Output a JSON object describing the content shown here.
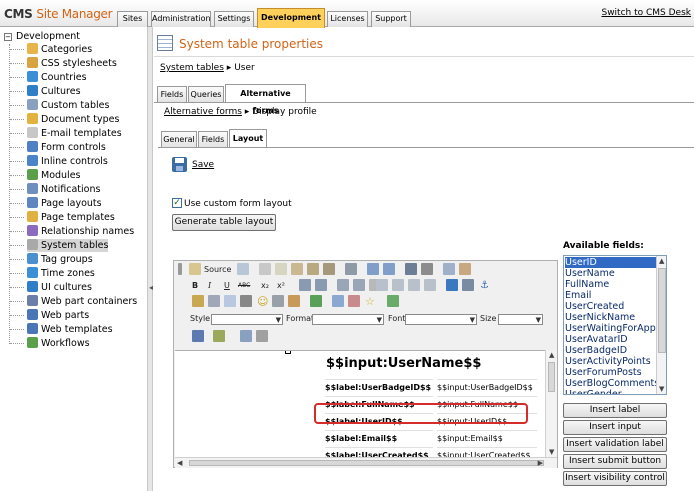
{
  "app": {
    "logo_cms": "CMS",
    "logo_sm": "Site Manager",
    "switch_link": "Switch to CMS Desk"
  },
  "top_tabs": [
    {
      "label": "Sites"
    },
    {
      "label": "Administration"
    },
    {
      "label": "Settings"
    },
    {
      "label": "Development"
    },
    {
      "label": "Licenses"
    },
    {
      "label": "Support"
    }
  ],
  "tree": {
    "root": "Development",
    "items": [
      {
        "label": "Categories",
        "icon": "categories-icon",
        "color": "#e8b44a"
      },
      {
        "label": "CSS stylesheets",
        "icon": "css-icon",
        "color": "#d9a340"
      },
      {
        "label": "Countries",
        "icon": "globe-icon",
        "color": "#3b8fd6"
      },
      {
        "label": "Cultures",
        "icon": "globe-icon",
        "color": "#2f7fc8"
      },
      {
        "label": "Custom tables",
        "icon": "table-icon",
        "color": "#8aa0c0"
      },
      {
        "label": "Document types",
        "icon": "document-types-icon",
        "color": "#e3b23e"
      },
      {
        "label": "E-mail templates",
        "icon": "email-icon",
        "color": "#c7c7c7"
      },
      {
        "label": "Form controls",
        "icon": "form-controls-icon",
        "color": "#4f7fc4"
      },
      {
        "label": "Inline controls",
        "icon": "inline-controls-icon",
        "color": "#4b83c8"
      },
      {
        "label": "Modules",
        "icon": "modules-icon",
        "color": "#5aa04a"
      },
      {
        "label": "Notifications",
        "icon": "notifications-icon",
        "color": "#6f8fbf"
      },
      {
        "label": "Page layouts",
        "icon": "page-layouts-icon",
        "color": "#5f86c2"
      },
      {
        "label": "Page templates",
        "icon": "page-templates-icon",
        "color": "#e0b040"
      },
      {
        "label": "Relationship names",
        "icon": "relationship-icon",
        "color": "#8a6bbf"
      },
      {
        "label": "System tables",
        "icon": "system-tables-icon",
        "color": "#a9a9a9"
      },
      {
        "label": "Tag groups",
        "icon": "tag-icon",
        "color": "#4a8fd0"
      },
      {
        "label": "Time zones",
        "icon": "clock-icon",
        "color": "#3b8fd6"
      },
      {
        "label": "UI cultures",
        "icon": "globe-icon",
        "color": "#2f7fc8"
      },
      {
        "label": "Web part containers",
        "icon": "web-part-containers-icon",
        "color": "#6c7fa8"
      },
      {
        "label": "Web parts",
        "icon": "web-parts-icon",
        "color": "#4a76b8"
      },
      {
        "label": "Web templates",
        "icon": "web-templates-icon",
        "color": "#4a76b8"
      },
      {
        "label": "Workflows",
        "icon": "workflows-icon",
        "color": "#5aa04a"
      }
    ],
    "selected": "System tables"
  },
  "page": {
    "title": "System table properties",
    "breadcrumb_link": "System tables",
    "breadcrumb_sep": "▸",
    "breadcrumb_current": "User",
    "tabs": [
      {
        "label": "Fields"
      },
      {
        "label": "Queries"
      },
      {
        "label": "Alternative forms"
      }
    ],
    "breadcrumb2_link": "Alternative forms",
    "breadcrumb2_current": "Display profile",
    "subtabs": [
      {
        "label": "General"
      },
      {
        "label": "Fields"
      },
      {
        "label": "Layout"
      }
    ],
    "save_label": "Save",
    "use_custom_label": "Use custom form layout",
    "generate_label": "Generate table layout"
  },
  "editor": {
    "source_label": "Source",
    "style_label": "Style",
    "format_label": "Format",
    "font_label": "Font",
    "size_label": "Size",
    "big_field": "$$input:UserName$$",
    "rows": [
      {
        "label": "$$label:UserBadgeID$$",
        "input": "$$input:UserBadgeID$$"
      },
      {
        "label": "$$label:FullName$$",
        "input": "$$input:FullName$$"
      },
      {
        "label": "$$label:UserID$$",
        "input": "$$input:UserID$$"
      },
      {
        "label": "$$label:Email$$",
        "input": "$$input:Email$$"
      },
      {
        "label": "$$label:UserCreated$$",
        "input": "$$input:UserCreated$$"
      }
    ]
  },
  "available": {
    "title": "Available fields:",
    "fields": [
      "UserID",
      "UserName",
      "FullName",
      "Email",
      "UserCreated",
      "UserNickName",
      "UserWaitingForApproval",
      "UserAvatarID",
      "UserBadgeID",
      "UserActivityPoints",
      "UserForumPosts",
      "UserBlogComments",
      "UserGender"
    ],
    "selected": "UserID",
    "buttons": [
      {
        "label": "Insert label"
      },
      {
        "label": "Insert input"
      },
      {
        "label": "Insert validation label"
      },
      {
        "label": "Insert submit button"
      },
      {
        "label": "Insert visibility control"
      }
    ]
  }
}
